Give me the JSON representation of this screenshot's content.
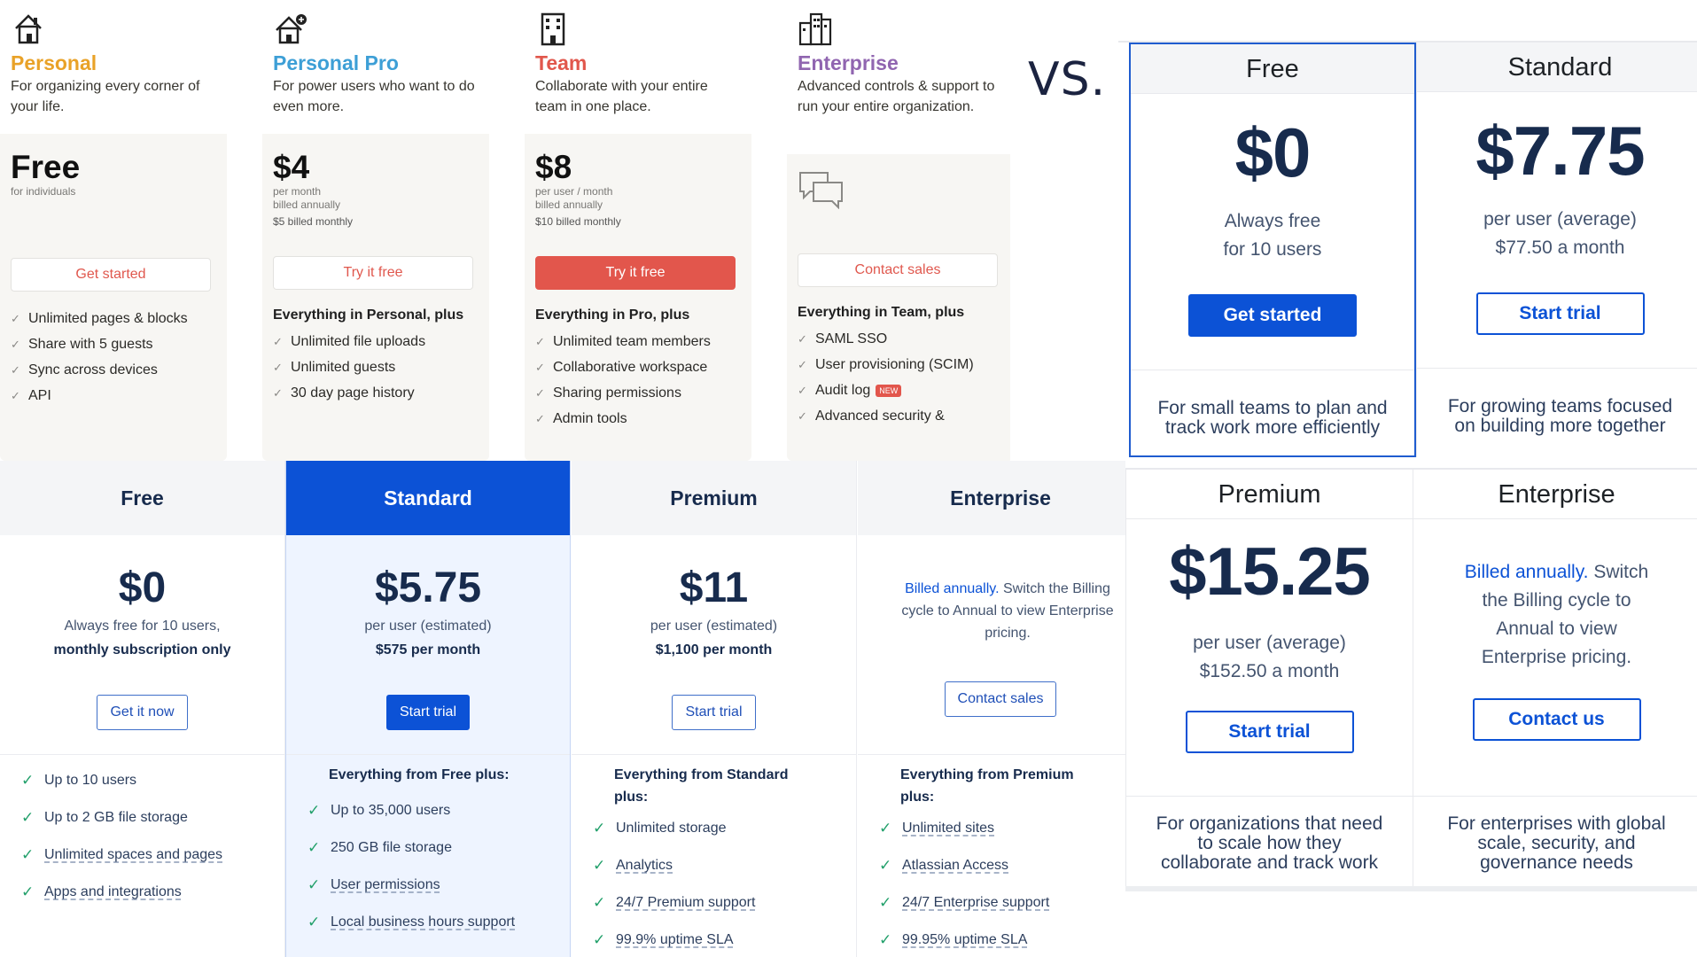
{
  "notion": {
    "plans": [
      {
        "name": "Personal",
        "icon": "house-icon",
        "color": "#e9a228",
        "desc": "For organizing every corner of your life.",
        "price": "Free",
        "price_lines": [
          "for individuals"
        ],
        "button": "Get started",
        "features_head": "",
        "features": [
          "Unlimited pages & blocks",
          "Share with 5 guests",
          "Sync across devices",
          "API"
        ]
      },
      {
        "name": "Personal Pro",
        "icon": "house-plus-icon",
        "color": "#3d9fd6",
        "desc": "For power users who want to do even more.",
        "price": "$4",
        "price_lines": [
          "per month",
          "billed annually"
        ],
        "price_bold": "$5 billed monthly",
        "button": "Try it free",
        "features_head": "Everything in Personal, plus",
        "features": [
          "Unlimited file uploads",
          "Unlimited guests",
          "30 day page history"
        ]
      },
      {
        "name": "Team",
        "icon": "building-icon",
        "color": "#e1574c",
        "desc": "Collaborate with your entire team in one place.",
        "price": "$8",
        "price_lines": [
          "per user / month",
          "billed annually"
        ],
        "price_bold": "$10 billed monthly",
        "button": "Try it free",
        "features_head": "Everything in Pro, plus",
        "features": [
          "Unlimited team members",
          "Collaborative workspace",
          "Sharing permissions",
          "Admin tools"
        ]
      },
      {
        "name": "Enterprise",
        "icon": "city-icon",
        "color": "#9065b0",
        "desc": "Advanced controls & support to run your entire organization.",
        "button": "Contact sales",
        "features_head": "Everything in Team, plus",
        "features": [
          "SAML SSO",
          "User provisioning (SCIM)",
          "Audit log",
          "Advanced security &"
        ],
        "badge": "NEW"
      }
    ]
  },
  "vs_text": "VS.",
  "atlassian_top": {
    "plans": [
      {
        "name": "Free",
        "price": "$0",
        "sub1": "Always free",
        "sub2": "for 10 users",
        "button": "Get started",
        "desc1": "For small teams to plan and",
        "desc2": "track work more efficiently"
      },
      {
        "name": "Standard",
        "price": "$7.75",
        "sub1": "per user (average)",
        "sub2": "$77.50 a month",
        "button": "Start trial",
        "desc1": "For growing teams focused",
        "desc2": "on building more together"
      }
    ]
  },
  "atlassian_bottom": {
    "premium": {
      "name": "Premium",
      "price": "$15.25",
      "sub1": "per user (average)",
      "sub2": "$152.50 a month",
      "button": "Start trial",
      "desc1": "For organizations that need",
      "desc2": "to scale how they",
      "desc3": "collaborate and track work"
    },
    "enterprise": {
      "name": "Enterprise",
      "link": "Billed annually.",
      "text1": " Switch",
      "text2": "the Billing cycle to",
      "text3": "Annual to view",
      "text4": "Enterprise pricing.",
      "button": "Contact us",
      "desc1": "For enterprises with global",
      "desc2": "scale, security, and",
      "desc3": "governance needs"
    }
  },
  "confluence": {
    "plans": [
      {
        "name": "Free",
        "price": "$0",
        "sub1": "Always free for 10 users,",
        "sub2": "monthly subscription only",
        "button": "Get it now",
        "features": [
          "Up to 10 users",
          "Up to 2 GB file storage",
          "Unlimited spaces and pages",
          "Apps and integrations"
        ]
      },
      {
        "name": "Standard",
        "price": "$5.75",
        "sub1": "per user (estimated)",
        "sub2": "$575 per month",
        "button": "Start trial",
        "features_head": "Everything from Free plus:",
        "features": [
          "Up to 35,000 users",
          "250 GB file storage",
          "User permissions",
          "Local business hours support"
        ]
      },
      {
        "name": "Premium",
        "price": "$11",
        "sub1": "per user (estimated)",
        "sub2": "$1,100 per month",
        "button": "Start trial",
        "features_head1": "Everything from Standard",
        "features_head2": "plus:",
        "features": [
          "Unlimited storage",
          "Analytics",
          "24/7 Premium support",
          "99.9% uptime SLA"
        ]
      },
      {
        "name": "Enterprise",
        "link": "Billed annually.",
        "text1": " Switch the Billing",
        "text2": "cycle to Annual to view Enterprise",
        "text3": "pricing.",
        "button": "Contact sales",
        "features_head1": "Everything from Premium",
        "features_head2": "plus:",
        "features": [
          "Unlimited sites",
          "Atlassian Access",
          "24/7 Enterprise support",
          "99.95% uptime SLA"
        ]
      }
    ]
  }
}
